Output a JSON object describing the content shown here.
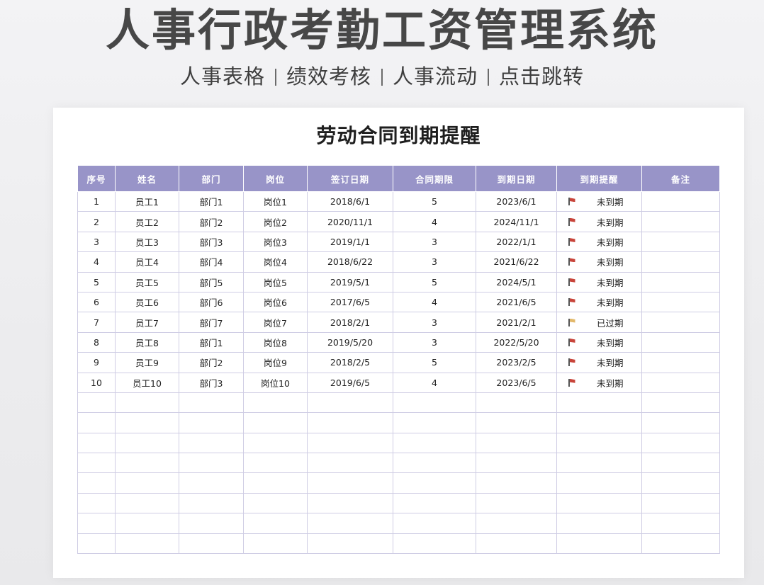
{
  "banner": {
    "title": "人事行政考勤工资管理系统",
    "nav": [
      "人事表格",
      "绩效考核",
      "人事流动",
      "点击跳转"
    ]
  },
  "sheet": {
    "title": "劳动合同到期提醒",
    "columns": [
      "序号",
      "姓名",
      "部门",
      "岗位",
      "签订日期",
      "合同期限",
      "到期日期",
      "到期提醒",
      "备注"
    ],
    "rows": [
      {
        "no": "1",
        "name": "员工1",
        "dept": "部门1",
        "post": "岗位1",
        "sign": "2018/6/1",
        "term": "5",
        "expire": "2023/6/1",
        "remind": "未到期",
        "flag": "red",
        "note": ""
      },
      {
        "no": "2",
        "name": "员工2",
        "dept": "部门2",
        "post": "岗位2",
        "sign": "2020/11/1",
        "term": "4",
        "expire": "2024/11/1",
        "remind": "未到期",
        "flag": "red",
        "note": ""
      },
      {
        "no": "3",
        "name": "员工3",
        "dept": "部门3",
        "post": "岗位3",
        "sign": "2019/1/1",
        "term": "3",
        "expire": "2022/1/1",
        "remind": "未到期",
        "flag": "red",
        "note": ""
      },
      {
        "no": "4",
        "name": "员工4",
        "dept": "部门4",
        "post": "岗位4",
        "sign": "2018/6/22",
        "term": "3",
        "expire": "2021/6/22",
        "remind": "未到期",
        "flag": "red",
        "note": ""
      },
      {
        "no": "5",
        "name": "员工5",
        "dept": "部门5",
        "post": "岗位5",
        "sign": "2019/5/1",
        "term": "5",
        "expire": "2024/5/1",
        "remind": "未到期",
        "flag": "red",
        "note": ""
      },
      {
        "no": "6",
        "name": "员工6",
        "dept": "部门6",
        "post": "岗位6",
        "sign": "2017/6/5",
        "term": "4",
        "expire": "2021/6/5",
        "remind": "未到期",
        "flag": "red",
        "note": ""
      },
      {
        "no": "7",
        "name": "员工7",
        "dept": "部门7",
        "post": "岗位7",
        "sign": "2018/2/1",
        "term": "3",
        "expire": "2021/2/1",
        "remind": "已过期",
        "flag": "yellow",
        "note": ""
      },
      {
        "no": "8",
        "name": "员工8",
        "dept": "部门1",
        "post": "岗位8",
        "sign": "2019/5/20",
        "term": "3",
        "expire": "2022/5/20",
        "remind": "未到期",
        "flag": "red",
        "note": ""
      },
      {
        "no": "9",
        "name": "员工9",
        "dept": "部门2",
        "post": "岗位9",
        "sign": "2018/2/5",
        "term": "5",
        "expire": "2023/2/5",
        "remind": "未到期",
        "flag": "red",
        "note": ""
      },
      {
        "no": "10",
        "name": "员工10",
        "dept": "部门3",
        "post": "岗位10",
        "sign": "2019/6/5",
        "term": "4",
        "expire": "2023/6/5",
        "remind": "未到期",
        "flag": "red",
        "note": ""
      }
    ],
    "empty_rows": 8
  },
  "colors": {
    "header_bg": "#9894c8",
    "flag_red": "#c8443a",
    "flag_yellow": "#e2b86a",
    "grid_line": "#cfcde4"
  },
  "icons": {
    "remind_flag": "flag-icon"
  }
}
